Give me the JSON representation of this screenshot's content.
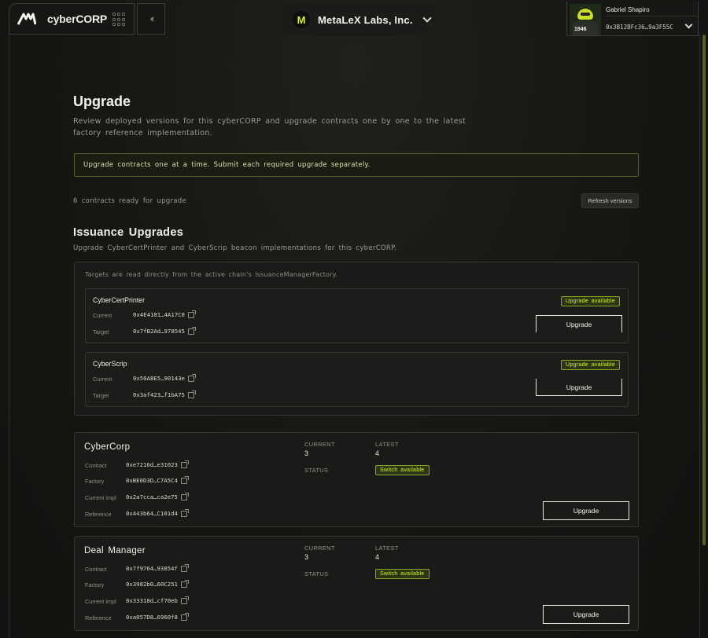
{
  "brand": {
    "name_prefix": "cyber",
    "name_suffix": "CORP"
  },
  "org": {
    "logo_letter": "M",
    "name": "MetaLeX Labs, Inc."
  },
  "user": {
    "name": "Gabriel Shapiro",
    "address": "0x3B12BFc36…9a3F55C",
    "avatar_number": "1946"
  },
  "page": {
    "title": "Upgrade",
    "description": "Review deployed versions for this cyberCORP and upgrade contracts one by one to the latest factory reference implementation.",
    "notice": "Upgrade contracts one at a time. Submit each required upgrade separately.",
    "ready_count_text": "6 contracts ready for upgrade",
    "refresh_label": "Refresh versions"
  },
  "issuance": {
    "title": "Issuance Upgrades",
    "description": "Upgrade CyberCertPrinter and CyberScrip beacon implementations for this cyberCORP.",
    "note": "Targets are read directly from the active chain's IssuanceManagerFactory.",
    "items": [
      {
        "name": "CyberCertPrinter",
        "badge": "Upgrade available",
        "current_label": "Current",
        "current": "0x4E4181…4A17C0",
        "target_label": "Target",
        "target": "0x7fB2Ad…978545",
        "button": "Upgrade"
      },
      {
        "name": "CyberScrip",
        "badge": "Upgrade available",
        "current_label": "Current",
        "current": "0x50A8E5…90143e",
        "target_label": "Target",
        "target": "0x3af423…f1bA75",
        "button": "Upgrade"
      }
    ]
  },
  "contracts": [
    {
      "title": "CyberCorp",
      "rows": [
        {
          "label": "Contract",
          "value": "0xe7216d…e31023"
        },
        {
          "label": "Factory",
          "value": "0xBE0D3D…C7A5C4"
        },
        {
          "label": "Current impl",
          "value": "0x2a7cca…ca2e75"
        },
        {
          "label": "Reference",
          "value": "0x443b64…C101d4"
        }
      ],
      "current_label": "CURRENT",
      "current": "3",
      "latest_label": "LATEST",
      "latest": "4",
      "status_label": "STATUS",
      "status": "Switch available",
      "button": "Upgrade"
    },
    {
      "title": "Deal Manager",
      "rows": [
        {
          "label": "Contract",
          "value": "0x7f9764…93854f"
        },
        {
          "label": "Factory",
          "value": "0x3982b0…60C251"
        },
        {
          "label": "Current impl",
          "value": "0x33318d…cf70eb"
        },
        {
          "label": "Reference",
          "value": "0xa057D8…6960f8"
        }
      ],
      "current_label": "CURRENT",
      "current": "3",
      "latest_label": "LATEST",
      "latest": "4",
      "status_label": "STATUS",
      "status": "Switch available",
      "button": "Upgrade"
    }
  ],
  "colors": {
    "accent": "#d6ef3a",
    "background": "#151612",
    "card": "#1a1b18"
  },
  "icons": [
    "metalex-logo-icon",
    "apps-grid-icon",
    "collapse-chevron-icon",
    "chevron-down-icon",
    "external-link-icon"
  ]
}
